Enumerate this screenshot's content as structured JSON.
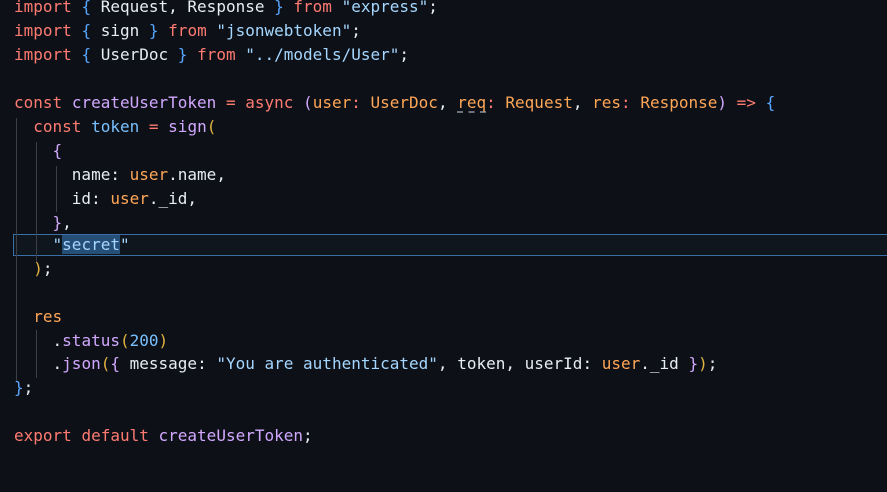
{
  "lines": [
    [
      "import",
      "{",
      "Request, Response",
      "}",
      "from",
      "\"express\"",
      ";"
    ],
    [
      "import",
      "{",
      "sign",
      "}",
      "from",
      "\"jsonwebtoken\"",
      ";"
    ],
    [
      "import",
      "{",
      "UserDoc",
      "}",
      "from",
      "\"../models/User\"",
      ";"
    ],
    [
      "const",
      "createUserToken",
      "=",
      "async",
      "(",
      "user",
      ":",
      "UserDoc",
      ",",
      "req",
      ":",
      "Request",
      ",",
      "res",
      ":",
      "Response",
      ")",
      "=>",
      "{"
    ],
    [
      "const",
      "token",
      "=",
      "sign",
      "("
    ],
    [
      "{"
    ],
    [
      "name",
      ":",
      "user",
      ".",
      "name",
      ","
    ],
    [
      "id",
      ":",
      "user",
      ".",
      "_id",
      ","
    ],
    [
      "}",
      ","
    ],
    [
      "\"",
      "secret",
      "\""
    ],
    [
      ")",
      ";"
    ],
    [
      "res"
    ],
    [
      ".",
      "status",
      "(",
      "200",
      ")"
    ],
    [
      ".",
      "json",
      "(",
      "{",
      "message",
      ":",
      "\"You are authenticated\"",
      ",",
      "token",
      ",",
      "userId",
      ":",
      "user",
      ".",
      "_id",
      "}",
      ")",
      ";"
    ],
    [
      "}",
      ";"
    ],
    [
      "export",
      "default",
      "createUserToken",
      ";"
    ]
  ]
}
